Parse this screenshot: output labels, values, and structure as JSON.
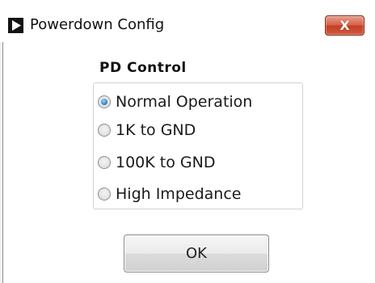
{
  "window": {
    "title": "Powerdown Config",
    "close_label": "X"
  },
  "group": {
    "title": "PD Control",
    "options": [
      {
        "label": "Normal Operation",
        "checked": true
      },
      {
        "label": "1K to GND",
        "checked": false
      },
      {
        "label": "100K to GND",
        "checked": false
      },
      {
        "label": "High Impedance",
        "checked": false
      }
    ]
  },
  "buttons": {
    "ok_label": "OK"
  }
}
